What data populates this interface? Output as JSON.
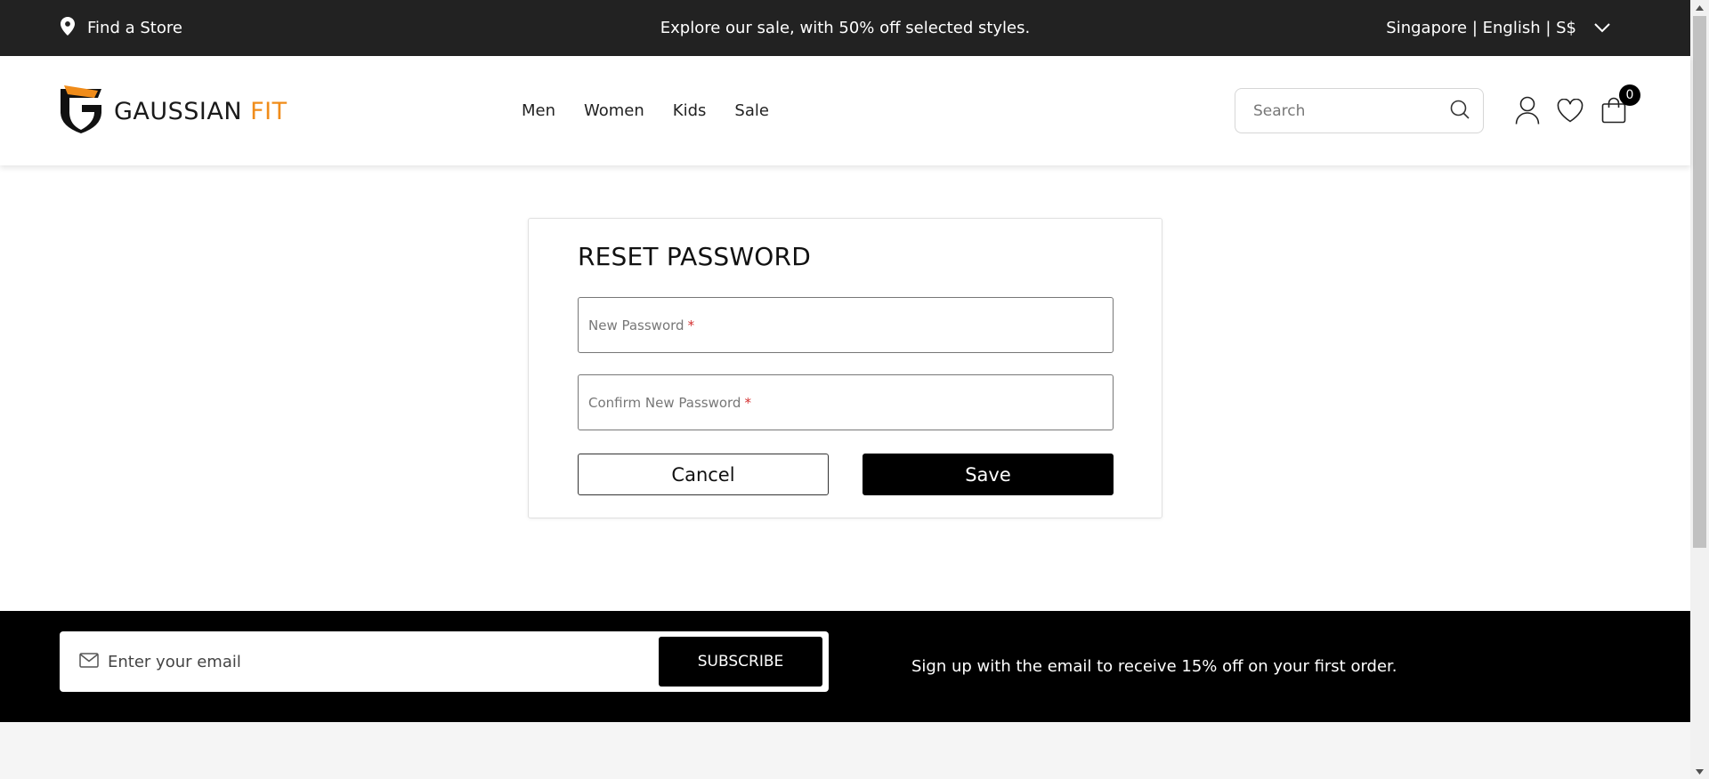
{
  "topbar": {
    "store_link": "Find a Store",
    "promo": "Explore our sale, with 50% off selected styles.",
    "locale": "Singapore | English | S$"
  },
  "header": {
    "logo_main": "GAUSSIAN",
    "logo_accent": "FIT",
    "nav": [
      "Men",
      "Women",
      "Kids",
      "Sale"
    ],
    "search_placeholder": "Search",
    "cart_count": "0"
  },
  "form": {
    "title": "RESET PASSWORD",
    "new_password_label": "New Password",
    "confirm_password_label": "Confirm New Password",
    "required_mark": "*",
    "cancel_label": "Cancel",
    "save_label": "Save"
  },
  "newsletter": {
    "email_placeholder": "Enter your email",
    "subscribe_label": "SUBSCRIBE",
    "tagline": "Sign up with the email to receive 15% off on your first order."
  },
  "colors": {
    "topbar_bg": "#222222",
    "brand_accent": "#f08c1a",
    "required": "#d32f2f"
  },
  "icons": [
    "location-pin-icon",
    "chevron-down-icon",
    "search-icon",
    "user-icon",
    "heart-icon",
    "shopping-bag-icon",
    "mail-icon"
  ]
}
